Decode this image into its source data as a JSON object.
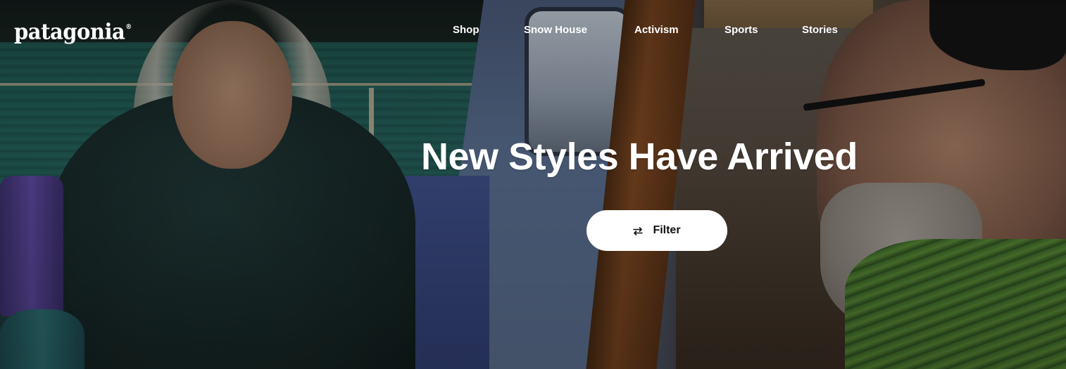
{
  "brand": {
    "logo_text": "patagonia",
    "trademark": "®"
  },
  "nav": {
    "items": [
      {
        "label": "Shop"
      },
      {
        "label": "Snow House"
      },
      {
        "label": "Activism"
      },
      {
        "label": "Sports"
      },
      {
        "label": "Stories"
      }
    ]
  },
  "hero": {
    "headline": "New Styles Have Arrived",
    "filter_button_label": "Filter",
    "filter_icon": "sliders-arrows-icon",
    "image_alt": "Two people sharing a meal aboard a boat"
  },
  "colors": {
    "text": "#ffffff",
    "button_bg": "#ffffff",
    "button_text": "#111111"
  }
}
